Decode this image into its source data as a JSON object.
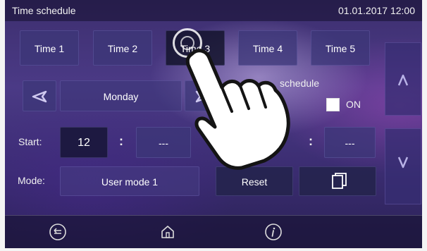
{
  "header": {
    "title": "Time schedule",
    "datetime": "01.01.2017  12:00"
  },
  "tabs": [
    {
      "label": "Time 1",
      "active": false
    },
    {
      "label": "Time 2",
      "active": false
    },
    {
      "label": "Time 3",
      "active": true
    },
    {
      "label": "Time 4",
      "active": false
    },
    {
      "label": "Time 5",
      "active": false
    }
  ],
  "day": {
    "value": "Monday",
    "prev_icon": "chevron-left-icon",
    "next_icon": "chevron-right-icon"
  },
  "schedule": {
    "label": "schedule",
    "toggle_label": "ON"
  },
  "start": {
    "label": "Start:",
    "hour": "12",
    "separator": ":",
    "minute": "---"
  },
  "end": {
    "separator": ":",
    "minute": "---"
  },
  "mode": {
    "label": "Mode:",
    "value": "User mode  1"
  },
  "actions": {
    "reset_label": "Reset",
    "copy_icon": "copy-icon"
  },
  "side_nav": {
    "up_icon": "chevron-up-icon",
    "down_icon": "chevron-down-icon"
  },
  "bottom_nav": {
    "back_icon": "back-icon",
    "home_icon": "home-icon",
    "info_icon": "info-icon"
  },
  "colors": {
    "background": "#45357d",
    "button": "#3c3778",
    "active_tab": "#14142d"
  }
}
